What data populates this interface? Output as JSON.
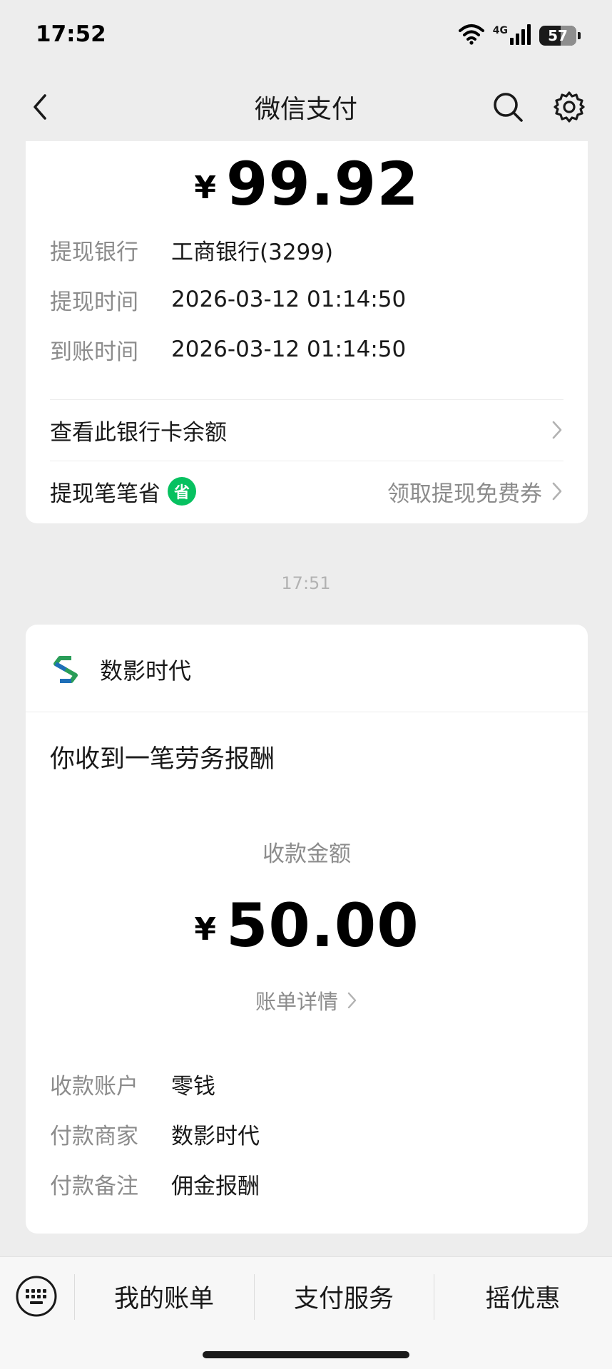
{
  "status_bar": {
    "time": "17:52",
    "network": "4G",
    "battery": "57",
    "battery_level": 0.57
  },
  "nav": {
    "title": "微信支付",
    "back_icon": "chevron-left-icon",
    "search_icon": "search-icon",
    "settings_icon": "gear-icon"
  },
  "withdraw_card": {
    "currency": "¥",
    "amount": "99.92",
    "rows": [
      {
        "key": "提现银行",
        "value": "工商银行(3299)"
      },
      {
        "key": "提现时间",
        "value": "2026-03-12 01:14:50"
      },
      {
        "key": "到账时间",
        "value": "2026-03-12 01:14:50"
      }
    ],
    "balance_link": "查看此银行卡余额",
    "savings_label": "提现笔笔省",
    "savings_badge": "省",
    "savings_right": "领取提现免费券"
  },
  "timestamp": "17:51",
  "payment_card": {
    "merchant": "数影时代",
    "title": "你收到一笔劳务报酬",
    "amount_label": "收款金额",
    "currency": "¥",
    "amount": "50.00",
    "detail_link": "账单详情",
    "rows": [
      {
        "key": "收款账户",
        "value": "零钱"
      },
      {
        "key": "付款商家",
        "value": "数影时代"
      },
      {
        "key": "付款备注",
        "value": "佣金报酬"
      }
    ]
  },
  "bottom_bar": {
    "keyboard_icon": "keyboard-icon",
    "tabs": [
      "我的账单",
      "支付服务",
      "摇优惠"
    ]
  },
  "colors": {
    "background": "#ededed",
    "card": "#ffffff",
    "accent_green": "#07c160",
    "secondary_text": "#8c8c8c"
  }
}
